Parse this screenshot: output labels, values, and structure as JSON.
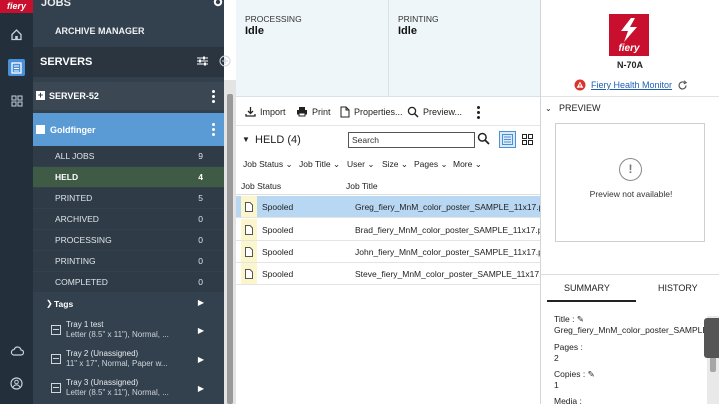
{
  "rail": {
    "logo": "fiery"
  },
  "sidebar": {
    "jobs_title": "JOBS",
    "archive_manager": "ARCHIVE MANAGER",
    "servers_title": "SERVERS",
    "server_name": "SERVER-52",
    "printer_name": "Goldfinger",
    "job_lists": [
      {
        "label": "ALL JOBS",
        "count": "9"
      },
      {
        "label": "HELD",
        "count": "4",
        "selected": true
      },
      {
        "label": "PRINTED",
        "count": "5"
      },
      {
        "label": "ARCHIVED",
        "count": "0"
      },
      {
        "label": "PROCESSING",
        "count": "0"
      },
      {
        "label": "PRINTING",
        "count": "0"
      },
      {
        "label": "COMPLETED",
        "count": "0"
      }
    ],
    "tags_label": "Tags",
    "trays": [
      {
        "line1": "Tray 1 test",
        "line2": "Letter (8.5\" x 11\"), Normal, ..."
      },
      {
        "line1": "Tray 2 (Unassigned)",
        "line2": "11\" x 17\", Normal, Paper w..."
      },
      {
        "line1": "Tray 3 (Unassigned)",
        "line2": "Letter (8.5\" x 11\"), Normal, ..."
      }
    ]
  },
  "status": {
    "processing_label": "PROCESSING",
    "processing_value": "Idle",
    "printing_label": "PRINTING",
    "printing_value": "Idle"
  },
  "toolbar": {
    "import": "Import",
    "print": "Print",
    "properties": "Properties...",
    "preview": "Preview..."
  },
  "held": {
    "title": "HELD (4)",
    "search_placeholder": "Search"
  },
  "filters": [
    "Job Status",
    "Job Title",
    "User",
    "Size",
    "Pages",
    "More"
  ],
  "table": {
    "columns": [
      "Job Status",
      "Job Title"
    ],
    "rows": [
      {
        "status": "Spooled",
        "title": "Greg_fiery_MnM_color_poster_SAMPLE_11x17.pdf"
      },
      {
        "status": "Spooled",
        "title": "Brad_fiery_MnM_color_poster_SAMPLE_11x17.pdf"
      },
      {
        "status": "Spooled",
        "title": "John_fiery_MnM_color_poster_SAMPLE_11x17.pdf"
      },
      {
        "status": "Spooled",
        "title": "Steve_fiery_MnM_color_poster_SAMPLE_11x17.pdf"
      }
    ]
  },
  "right_panel": {
    "brand": "fiery",
    "model": "N-70A",
    "health_monitor": "Fiery Health Monitor",
    "preview_label": "PREVIEW",
    "preview_message": "Preview not available!",
    "tab_summary": "SUMMARY",
    "tab_history": "HISTORY",
    "summary": {
      "title_label": "Title :",
      "title_value": "Greg_fiery_MnM_color_poster_SAMPLE_1",
      "pages_label": "Pages :",
      "pages_value": "2",
      "copies_label": "Copies :",
      "copies_value": "1",
      "media_label": "Media :"
    }
  },
  "colors": {
    "rail": "#23303c",
    "sidebar": "#33404d",
    "selected_printer": "#5b9bd5",
    "selected_row": "#b8d7f3",
    "brand_red": "#c8102e",
    "link": "#1f5fb4"
  }
}
